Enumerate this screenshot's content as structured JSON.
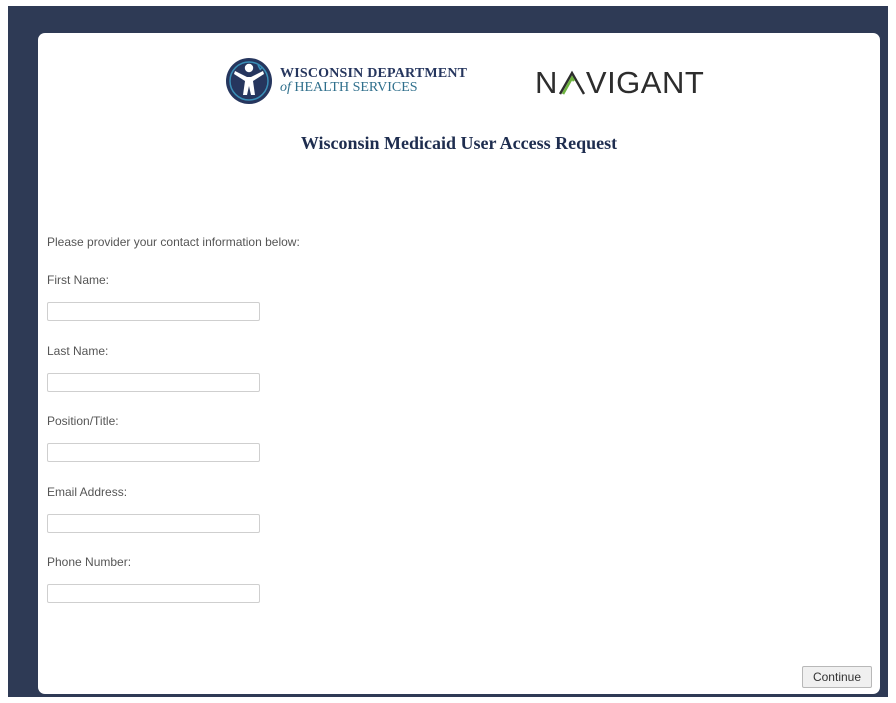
{
  "header": {
    "dhs_logo_line1": "WISCONSIN DEPARTMENT",
    "dhs_logo_of": "of",
    "dhs_logo_line2": "HEALTH SERVICES",
    "navigant_prefix": "N",
    "navigant_suffix": "VIGANT",
    "title": "Wisconsin Medicaid User Access Request"
  },
  "form": {
    "intro": "Please provider your contact information below:",
    "fields": [
      {
        "label": "First Name:",
        "value": "",
        "placeholder": ""
      },
      {
        "label": "Last Name:",
        "value": "",
        "placeholder": ""
      },
      {
        "label": "Position/Title:",
        "value": "",
        "placeholder": ""
      },
      {
        "label": "Email Address:",
        "value": "",
        "placeholder": ""
      },
      {
        "label": "Phone Number:",
        "value": "",
        "placeholder": ""
      }
    ],
    "continue_label": "Continue"
  },
  "colors": {
    "frame_background": "#2e3a55",
    "card_background": "#ffffff",
    "title_color": "#1e2d4f",
    "dhs_blue": "#26365e",
    "navigant_accent": "#6db33f"
  },
  "icons": {
    "dhs_emblem": "person-with-raised-arms-emblem",
    "navigant_a": "chevron-a-logo-mark"
  }
}
